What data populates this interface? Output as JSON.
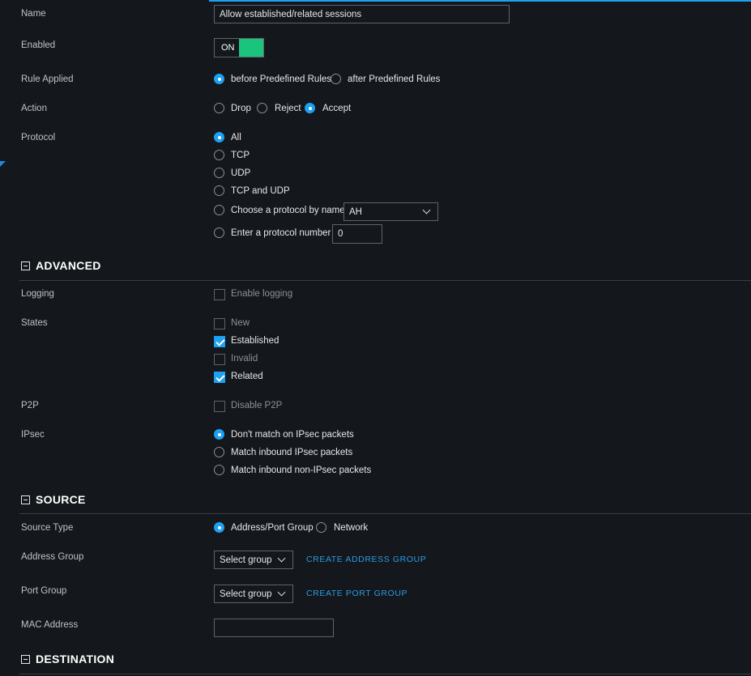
{
  "rule": {
    "name_label": "Name",
    "name_value": "Allow established/related sessions",
    "enabled_label": "Enabled",
    "enabled_toggle": "ON",
    "rule_applied_label": "Rule Applied",
    "rule_applied_options": [
      "before Predefined Rules",
      "after Predefined Rules"
    ],
    "action_label": "Action",
    "action_options": [
      "Drop",
      "Reject",
      "Accept"
    ],
    "protocol_label": "Protocol",
    "protocol_options": [
      "All",
      "TCP",
      "UDP",
      "TCP and UDP",
      "Choose a protocol by name",
      "Enter a protocol number"
    ],
    "protocol_name_value": "AH",
    "protocol_number_value": "0"
  },
  "advanced": {
    "title": "ADVANCED",
    "logging_label": "Logging",
    "logging_option": "Enable logging",
    "states_label": "States",
    "states_options": [
      "New",
      "Established",
      "Invalid",
      "Related"
    ],
    "p2p_label": "P2P",
    "p2p_option": "Disable P2P",
    "ipsec_label": "IPsec",
    "ipsec_options": [
      "Don't match on IPsec packets",
      "Match inbound IPsec packets",
      "Match inbound non-IPsec packets"
    ]
  },
  "source": {
    "title": "SOURCE",
    "source_type_label": "Source Type",
    "source_type_options": [
      "Address/Port Group",
      "Network"
    ],
    "address_group_label": "Address Group",
    "address_group_select": "Select group",
    "create_address_group": "CREATE ADDRESS GROUP",
    "port_group_label": "Port Group",
    "port_group_select": "Select group",
    "create_port_group": "CREATE PORT GROUP",
    "mac_label": "MAC Address",
    "mac_value": ""
  },
  "destination": {
    "title": "DESTINATION"
  },
  "colors": {
    "accent": "#1da1f2",
    "toggle_on": "#1bc47d",
    "background": "#14171b"
  }
}
